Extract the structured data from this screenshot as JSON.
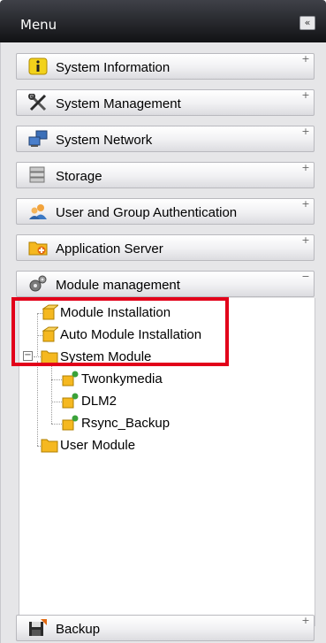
{
  "header": {
    "title": "Menu",
    "collapse_label": "«"
  },
  "sections": [
    {
      "label": "System Information",
      "toggle": "+"
    },
    {
      "label": "System Management",
      "toggle": "+"
    },
    {
      "label": "System Network",
      "toggle": "+"
    },
    {
      "label": "Storage",
      "toggle": "+"
    },
    {
      "label": "User and Group Authentication",
      "toggle": "+"
    },
    {
      "label": "Application Server",
      "toggle": "+"
    },
    {
      "label": "Module management",
      "toggle": "−"
    }
  ],
  "tree": {
    "module_installation": "Module Installation",
    "auto_module_installation": "Auto Module Installation",
    "system_module": "System Module",
    "system_module_expander": "−",
    "children": [
      "Twonkymedia",
      "DLM2",
      "Rsync_Backup"
    ],
    "user_module": "User Module"
  },
  "backup": {
    "label": "Backup",
    "toggle": "+"
  },
  "colors": {
    "highlight": "#e2001a",
    "header": "#26272c"
  }
}
